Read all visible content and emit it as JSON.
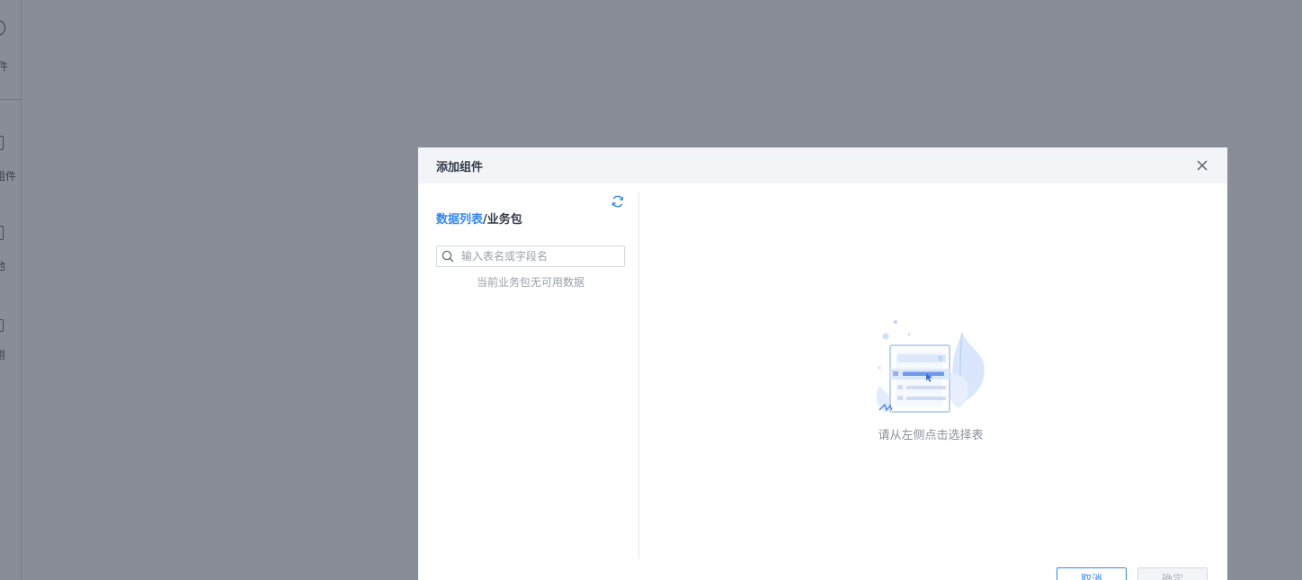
{
  "rail": {
    "items": [
      {
        "label": "件"
      },
      {
        "label": "组件"
      },
      {
        "label": "他"
      },
      {
        "label": "用"
      }
    ]
  },
  "dialog": {
    "title": "添加组件",
    "breadcrumb": {
      "link": "数据列表",
      "separator": "/",
      "current": "业务包"
    },
    "search": {
      "placeholder": "输入表名或字段名",
      "value": ""
    },
    "empty_text": "当前业务包无可用数据",
    "select_hint": "请从左侧点击选择表",
    "buttons": {
      "cancel": "取消",
      "ok": "确定"
    }
  },
  "colors": {
    "accent": "#3685f2",
    "header_bg": "#f2f4f7",
    "mask": "#8a8f9b"
  },
  "icons": {
    "close": "close-icon",
    "refresh": "refresh-icon",
    "search": "search-icon",
    "empty": "empty-table-illustration"
  }
}
